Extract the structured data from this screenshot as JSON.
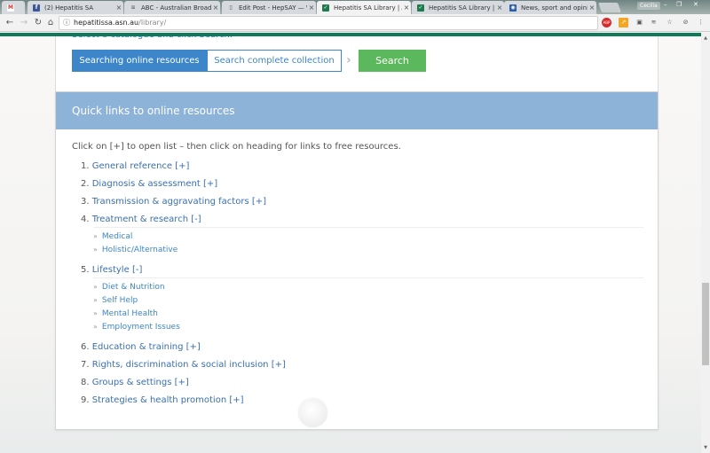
{
  "browser": {
    "tabs": [
      {
        "title": "",
        "icon": "gmail-icon",
        "fav_text": "M",
        "fav_color": "#ffffff",
        "fav_fg": "#d93025"
      },
      {
        "title": "(2) Hepatitis SA",
        "icon": "facebook-icon",
        "fav_text": "f",
        "fav_color": "#3b5998",
        "fav_fg": "#ffffff"
      },
      {
        "title": "ABC - Australian Broadc",
        "icon": "abc-icon",
        "fav_text": "≋",
        "fav_color": "#d6d9dd",
        "fav_fg": "#666666"
      },
      {
        "title": "Edit Post - HepSAY — W",
        "icon": "document-icon",
        "fav_text": "▯",
        "fav_color": "#d6d9dd",
        "fav_fg": "#555555"
      },
      {
        "title": "Hepatitis SA Library | A n",
        "icon": "hepsa-icon",
        "fav_text": "✓",
        "fav_color": "#1e7b4f",
        "fav_fg": "#ffffff",
        "active": true
      },
      {
        "title": "Hepatitis SA Library | A n",
        "icon": "hepsa-icon",
        "fav_text": "✓",
        "fav_color": "#1e7b4f",
        "fav_fg": "#ffffff"
      },
      {
        "title": "News, sport and opinion",
        "icon": "news-icon",
        "fav_text": "◉",
        "fav_color": "#2a5caa",
        "fav_fg": "#ffffff"
      }
    ],
    "user": "Cecilia",
    "url_host": "hepatitissa.asn.au",
    "url_path": "/library/"
  },
  "search_panel": {
    "hint": "Select a catalogue and click Search.",
    "option_active": "Searching online resources",
    "option_inactive": "Search complete collection",
    "search_label": "Search"
  },
  "quick_links": {
    "heading": "Quick links to online resources",
    "intro": "Click on [+] to open list – then click on heading for links to free resources.",
    "items": [
      {
        "num": "1.",
        "label": "General reference",
        "toggle": "[+]"
      },
      {
        "num": "2.",
        "label": "Diagnosis & assessment",
        "toggle": "[+]"
      },
      {
        "num": "3.",
        "label": "Transmission & aggravating factors",
        "toggle": "[+]"
      },
      {
        "num": "4.",
        "label": "Treatment & research",
        "toggle": "[-]",
        "children": [
          "Medical",
          "Holistic/Alternative"
        ]
      },
      {
        "num": "5.",
        "label": "Lifestyle",
        "toggle": "[-]",
        "children": [
          "Diet & Nutrition",
          "Self Help",
          "Mental Health",
          "Employment Issues"
        ]
      },
      {
        "num": "6.",
        "label": "Education & training",
        "toggle": "[+]"
      },
      {
        "num": "7.",
        "label": "Rights, discrimination & social inclusion",
        "toggle": "[+]"
      },
      {
        "num": "8.",
        "label": "Groups & settings",
        "toggle": "[+]"
      },
      {
        "num": "9.",
        "label": "Strategies & health promotion",
        "toggle": "[+]"
      }
    ]
  },
  "colors": {
    "site_green": "#0f7a5a",
    "panel_header": "#8db3d9",
    "link_blue": "#3a6fad",
    "button_blue": "#3d86c9",
    "search_green": "#5cb85c"
  }
}
